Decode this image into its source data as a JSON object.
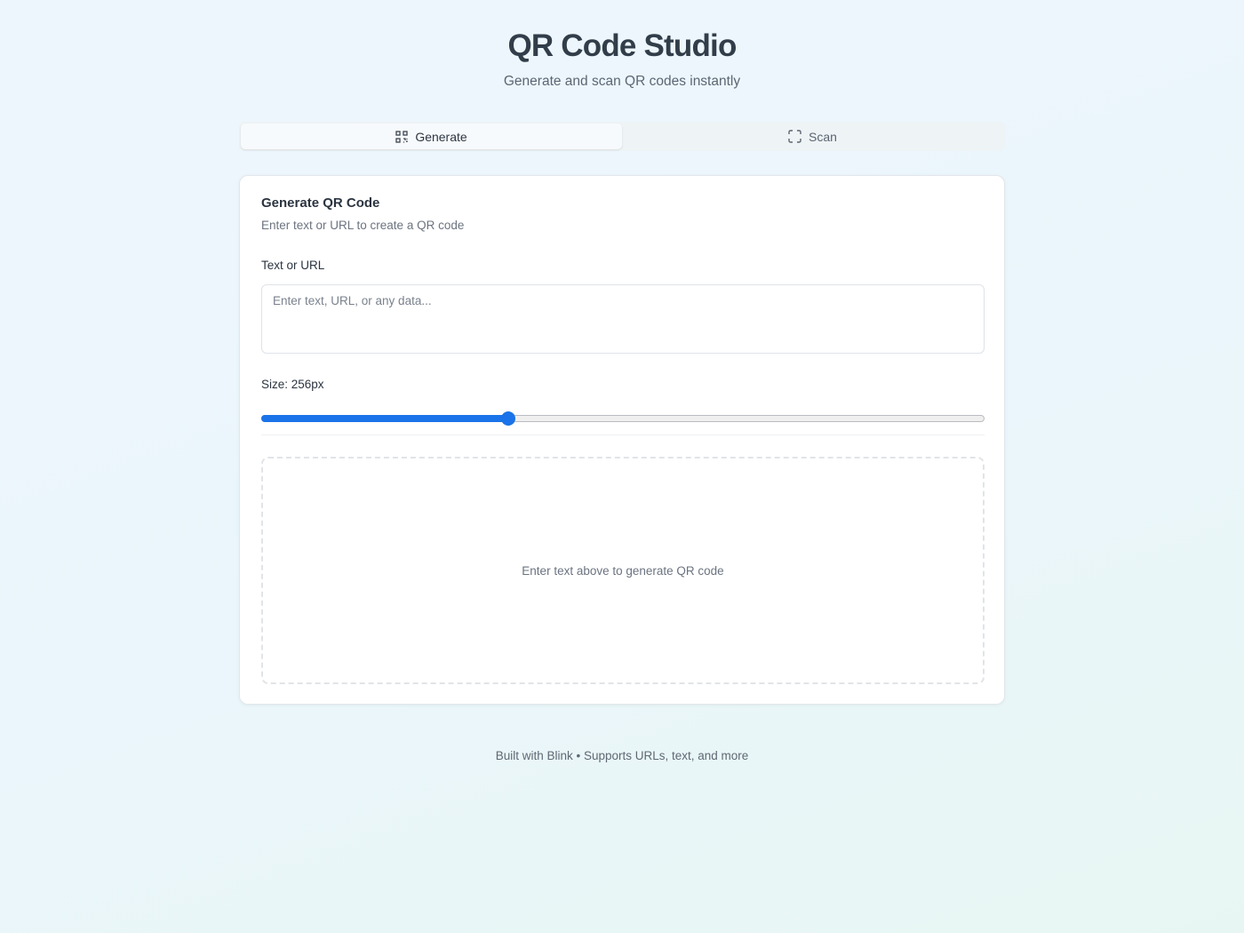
{
  "header": {
    "title": "QR Code Studio",
    "subtitle": "Generate and scan QR codes instantly"
  },
  "tabs": [
    {
      "label": "Generate",
      "icon": "qr-code-icon",
      "active": true
    },
    {
      "label": "Scan",
      "icon": "scan-frame-icon",
      "active": false
    }
  ],
  "card": {
    "title": "Generate QR Code",
    "description": "Enter text or URL to create a QR code",
    "input": {
      "label": "Text or URL",
      "placeholder": "Enter text, URL, or any data...",
      "value": ""
    },
    "size": {
      "label": "Size: 256px",
      "value": 256,
      "fraction": 0.342
    },
    "preview": {
      "empty_text": "Enter text above to generate QR code"
    }
  },
  "footer": {
    "text": "Built with Blink • Supports URLs, text, and more"
  },
  "colors": {
    "accent": "#1a73e8",
    "text": "#2b3440",
    "muted": "#6c7480"
  }
}
